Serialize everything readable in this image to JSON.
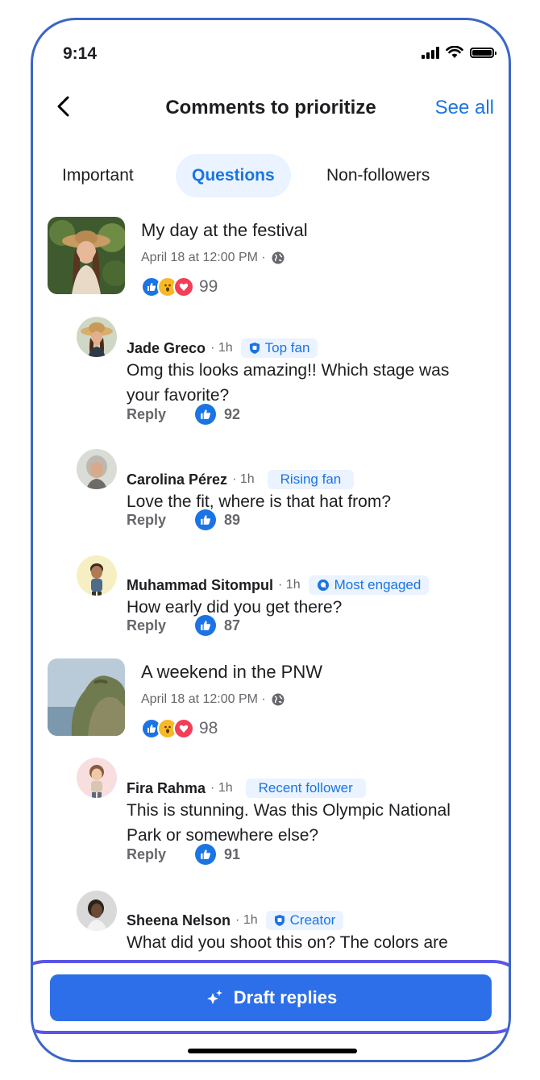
{
  "status_bar": {
    "time": "9:14"
  },
  "header": {
    "title": "Comments to prioritize",
    "see_all": "See all"
  },
  "tabs": [
    {
      "label": "Important",
      "active": false
    },
    {
      "label": "Questions",
      "active": true
    },
    {
      "label": "Non-followers",
      "active": false
    }
  ],
  "posts": [
    {
      "title": "My day at the festival",
      "meta": "April 18 at 12:00 PM ·",
      "reactions": [
        "like",
        "wow",
        "love"
      ],
      "reaction_count": "99",
      "comments": [
        {
          "name": "Jade Greco",
          "time": "· 1h",
          "badge": "Top fan",
          "badge_icon": "shield-icon",
          "text": "Omg this looks amazing!! Which stage was your favorite?",
          "reply": "Reply",
          "likes": "92"
        },
        {
          "name": "Carolina Pérez",
          "time": "· 1h",
          "badge": "Rising fan",
          "badge_icon": "",
          "text": "Love the fit, where is that hat from?",
          "reply": "Reply",
          "likes": "89"
        },
        {
          "name": "Muhammad Sitompul",
          "time": "· 1h",
          "badge": "Most engaged",
          "badge_icon": "chat-icon",
          "text": "How early did you get there?",
          "reply": "Reply",
          "likes": "87"
        }
      ]
    },
    {
      "title": "A weekend in the PNW",
      "meta": "April 18 at 12:00 PM ·",
      "reactions": [
        "like",
        "wow",
        "love"
      ],
      "reaction_count": "98",
      "comments": [
        {
          "name": "Fira Rahma",
          "time": "· 1h",
          "badge": "Recent follower",
          "badge_icon": "",
          "text": "This is stunning. Was this Olympic National Park or somewhere else?",
          "reply": "Reply",
          "likes": "91"
        },
        {
          "name": "Sheena Nelson",
          "time": "· 1h",
          "badge": "Creator",
          "badge_icon": "shield-icon",
          "text": "What did you shoot this on? The colors are incredible",
          "reply": "",
          "likes": ""
        }
      ]
    }
  ],
  "draft_button": {
    "label": "Draft replies"
  },
  "colors": {
    "accent": "#1b74e4",
    "button": "#2d6fe8",
    "highlight_ring": "#5b54e6",
    "phone_frame": "#3a66c8"
  }
}
